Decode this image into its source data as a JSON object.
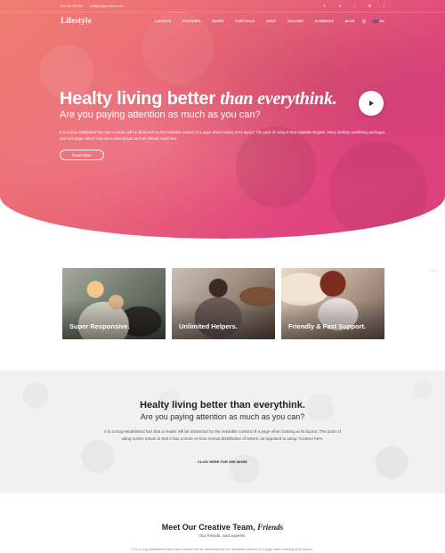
{
  "topbar": {
    "phone": "011 234 567 890",
    "email": "info@designzthame.com",
    "social_icons": [
      "twitter-icon",
      "pinterest-icon",
      "instagram-icon",
      "linkedin-icon",
      "facebook-icon"
    ]
  },
  "nav": {
    "logo": "Lifestyle",
    "links": [
      "LAYOUTS",
      "FEATURES",
      "PAGES",
      "PORTFOLIO",
      "SHOP",
      "GALLERY",
      "ELEMENTS",
      "BLOG"
    ],
    "language": "En"
  },
  "hero": {
    "title_main": "Healty living better ",
    "title_em": "than everythink.",
    "subtitle": "Are you paying attention as much as you can?",
    "paragraph": "It is a long established fact that a reader will be distracted by the readable content of a page when looking at its layout. The point of using is that readable English. Many desktop publishing packages and web page editors now use Lorem Ipsum as their default model text",
    "button": "Read More",
    "gradient": [
      "#ef7f72",
      "#ea6478",
      "#e0457f"
    ]
  },
  "features": [
    {
      "label": "Super Responsive."
    },
    {
      "label": "Unlimited Helpers."
    },
    {
      "label": "Friendly & Fast Support."
    }
  ],
  "band": {
    "title": "Healty living better than everythink.",
    "subtitle": "Are you paying attention as much as you can?",
    "paragraph": "It is a long established fact that a reader will be distracted by the readable content of a page when looking at its layout. The point of using Lorem Ipsum is that it has a more-or-less normal distribution of letters, as opposed to using 'Content here.",
    "link": "CLICK HERE FOR SEE MORE"
  },
  "team": {
    "title_main": "Meet Our Creative Team, ",
    "title_em": "Friends",
    "subtitle": "Our friends, and experts.",
    "paragraph": "It is a long established fact that a reader will be distracted by the readable content of a page when looking at its layout."
  }
}
